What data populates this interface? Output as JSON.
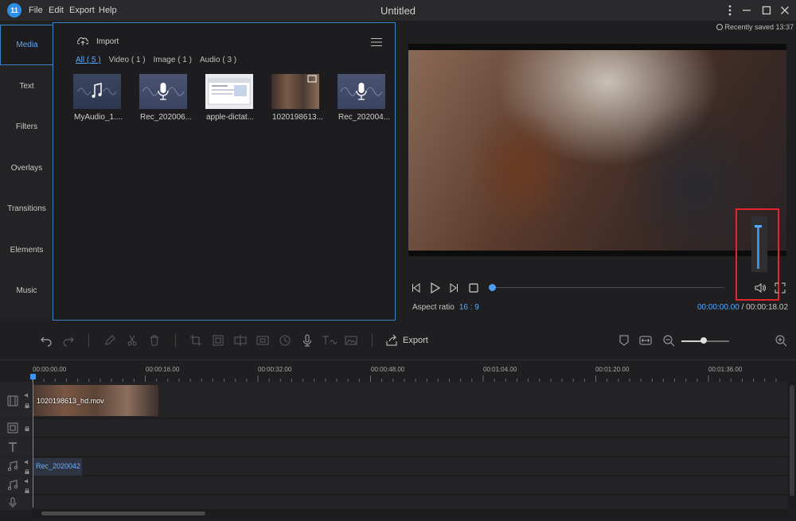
{
  "app": {
    "title": "Untitled",
    "menu": [
      "File",
      "Edit",
      "Export",
      "Help"
    ],
    "logo_text": "11"
  },
  "status": {
    "saved": "Recently saved 13:37"
  },
  "sidebar": {
    "tabs": [
      "Media",
      "Text",
      "Filters",
      "Overlays",
      "Transitions",
      "Elements",
      "Music"
    ],
    "active": "Media"
  },
  "media": {
    "import_label": "Import",
    "filters": [
      "All ( 5 )",
      "Video ( 1 )",
      "Image ( 1 )",
      "Audio ( 3 )"
    ],
    "items": [
      {
        "name": "MyAudio_1....",
        "kind": "audio"
      },
      {
        "name": "Rec_202006...",
        "kind": "recording"
      },
      {
        "name": "apple-dictat...",
        "kind": "image"
      },
      {
        "name": "1020198613...",
        "kind": "video"
      },
      {
        "name": "Rec_202004...",
        "kind": "recording"
      }
    ]
  },
  "preview": {
    "aspect_label": "Aspect ratio",
    "aspect_value": "16 : 9",
    "current_time": "00:00:00.00",
    "separator": "/",
    "total_time": "00:00:18.02",
    "volume_level": 1.0
  },
  "toolbar": {
    "export_label": "Export",
    "zoom_level": 0.45
  },
  "timeline": {
    "ruler": [
      "00:00:00.00",
      "00:00:16.00",
      "00:00:32.00",
      "00:00:48.00",
      "00:01:04.00",
      "00:01:20.00",
      "00:01:36.00"
    ],
    "video_clip": "1020198613_hd.mov",
    "audio_clip": "Rec_2020042"
  },
  "colors": {
    "accent": "#3f95ee",
    "highlight": "#e2262b",
    "background": "#1f1f21"
  }
}
